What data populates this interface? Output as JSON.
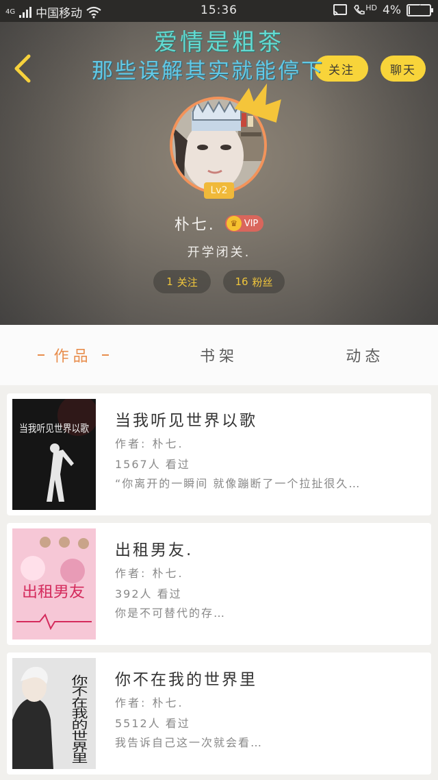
{
  "status_bar": {
    "network": "4G",
    "carrier": "中国移动",
    "time": "15:36",
    "hd_label": "HD",
    "battery_percent_label": "4%",
    "battery_level": 0.04
  },
  "header": {
    "overlay_line1": "爱情是粗茶",
    "overlay_line2": "那些误解其实就能停下",
    "follow_label": "关注",
    "chat_label": "聊天",
    "level": "Lv2",
    "username": "朴七.",
    "vip_label": "VIP",
    "bio": "开学闭关.",
    "follow_count": "1",
    "follow_text": "关注",
    "fans_count": "16",
    "fans_text": "粉丝"
  },
  "tabs": [
    {
      "label": "作品",
      "active": true
    },
    {
      "label": "书架",
      "active": false
    },
    {
      "label": "动态",
      "active": false
    }
  ],
  "books": [
    {
      "title": "当我听见世界以歌",
      "author": "作者: 朴七.",
      "views": "1567人 看过",
      "excerpt": "“你离开的一瞬间 就像蹦断了一个拉扯很久…",
      "cover_text": "当我听见世界以歌"
    },
    {
      "title": "出租男友.",
      "author": "作者: 朴七.",
      "views": "392人 看过",
      "excerpt": "你是不可替代的存…",
      "cover_text": "出租男友"
    },
    {
      "title": "你不在我的世界里",
      "author": "作者: 朴七.",
      "views": "5512人 看过",
      "excerpt": "我告诉自己这一次就会看…",
      "cover_text": "你不在我的世界里"
    }
  ],
  "colors": {
    "accent": "#e88d4c",
    "button_yellow": "#f8d43a",
    "stat_text": "#f0c63c",
    "overlay_text": "#63d9d0"
  }
}
